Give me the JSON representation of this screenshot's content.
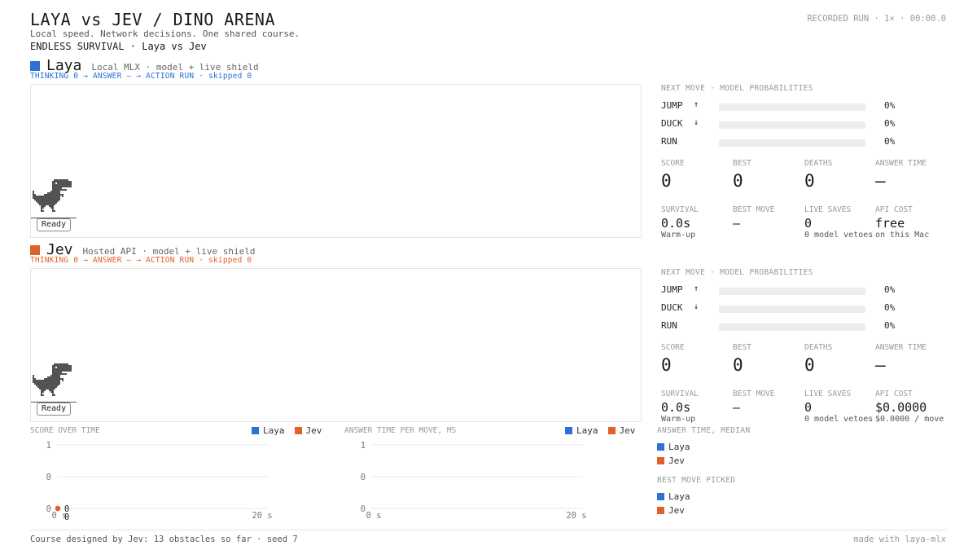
{
  "header": {
    "title": "LAYA vs JEV  /  DINO ARENA",
    "tagline": "Local speed. Network decisions. One shared course.",
    "mode": "ENDLESS SURVIVAL  ·  Laya vs Jev",
    "recorded": "RECORDED RUN · 1× · 00:00.0"
  },
  "colors": {
    "laya": "#2a72d4",
    "jev": "#e0612a"
  },
  "lanes": [
    {
      "name": "Laya",
      "desc": "Local MLX · model + live shield",
      "status": {
        "thinking": "THINKING 0",
        "answer": "ANSWER —",
        "action": "ACTION RUN",
        "skipped": "skipped 0"
      },
      "ready": "Ready",
      "probs": {
        "label": "NEXT MOVE · MODEL PROBABILITIES",
        "rows": [
          {
            "name": "JUMP",
            "arrow": "↑",
            "pct": "0%",
            "value": 0
          },
          {
            "name": "DUCK",
            "arrow": "↓",
            "pct": "0%",
            "value": 0
          },
          {
            "name": "RUN",
            "arrow": "",
            "pct": "0%",
            "value": 0
          }
        ]
      },
      "stats": [
        {
          "label": "SCORE",
          "value": "0"
        },
        {
          "label": "BEST",
          "value": "0"
        },
        {
          "label": "DEATHS",
          "value": "0"
        },
        {
          "label": "ANSWER TIME",
          "value": "—"
        }
      ],
      "stats2": [
        {
          "label": "SURVIVAL",
          "value": "0.0s",
          "sub": "Warm-up"
        },
        {
          "label": "BEST MOVE",
          "value": "—",
          "sub": ""
        },
        {
          "label": "LIVE SAVES",
          "value": "0",
          "sub": "0 model vetoes"
        },
        {
          "label": "API COST",
          "value": "free",
          "sub": "on this Mac"
        }
      ]
    },
    {
      "name": "Jev",
      "desc": "Hosted API · model + live shield",
      "status": {
        "thinking": "THINKING 0",
        "answer": "ANSWER —",
        "action": "ACTION RUN",
        "skipped": "skipped 0"
      },
      "ready": "Ready",
      "probs": {
        "label": "NEXT MOVE · MODEL PROBABILITIES",
        "rows": [
          {
            "name": "JUMP",
            "arrow": "↑",
            "pct": "0%",
            "value": 0
          },
          {
            "name": "DUCK",
            "arrow": "↓",
            "pct": "0%",
            "value": 0
          },
          {
            "name": "RUN",
            "arrow": "",
            "pct": "0%",
            "value": 0
          }
        ]
      },
      "stats": [
        {
          "label": "SCORE",
          "value": "0"
        },
        {
          "label": "BEST",
          "value": "0"
        },
        {
          "label": "DEATHS",
          "value": "0"
        },
        {
          "label": "ANSWER TIME",
          "value": "—"
        }
      ],
      "stats2": [
        {
          "label": "SURVIVAL",
          "value": "0.0s",
          "sub": "Warm-up"
        },
        {
          "label": "BEST MOVE",
          "value": "—",
          "sub": ""
        },
        {
          "label": "LIVE SAVES",
          "value": "0",
          "sub": "0 model vetoes"
        },
        {
          "label": "API COST",
          "value": "$0.0000",
          "sub": "$0.0000 / move"
        }
      ]
    }
  ],
  "charts": {
    "legend": {
      "laya": "Laya",
      "jev": "Jev"
    },
    "score": {
      "title": "SCORE OVER TIME"
    },
    "answer": {
      "title": "ANSWER TIME PER MOVE, MS"
    }
  },
  "chart_data": [
    {
      "type": "scatter",
      "title": "SCORE OVER TIME",
      "y_ticks": [
        "1",
        "0",
        "0"
      ],
      "x_ticks": [
        "0 s",
        "20 s"
      ],
      "xlim": [
        0,
        20
      ],
      "series": [
        {
          "name": "Laya",
          "color": "#2a72d4",
          "x": [
            0
          ],
          "y": [
            0
          ]
        },
        {
          "name": "Jev",
          "color": "#e0612a",
          "x": [
            0
          ],
          "y": [
            0
          ]
        }
      ],
      "point_labels": [
        "0",
        "0"
      ]
    },
    {
      "type": "line",
      "title": "ANSWER TIME PER MOVE, MS",
      "y_ticks": [
        "1",
        "0",
        "0"
      ],
      "x_ticks": [
        "0 s",
        "20 s"
      ],
      "xlim": [
        0,
        20
      ],
      "series": [
        {
          "name": "Laya",
          "color": "#2a72d4",
          "x": [],
          "y": []
        },
        {
          "name": "Jev",
          "color": "#e0612a",
          "x": [],
          "y": []
        }
      ]
    }
  ],
  "side": {
    "median_label": "ANSWER TIME, MEDIAN",
    "best_label": "BEST MOVE PICKED",
    "median": [
      "Laya",
      "Jev"
    ],
    "best": [
      "Laya",
      "Jev"
    ]
  },
  "footer": {
    "left": "Course designed by Jev: 13 obstacles so far · seed 7",
    "right": "made with laya-mlx"
  }
}
